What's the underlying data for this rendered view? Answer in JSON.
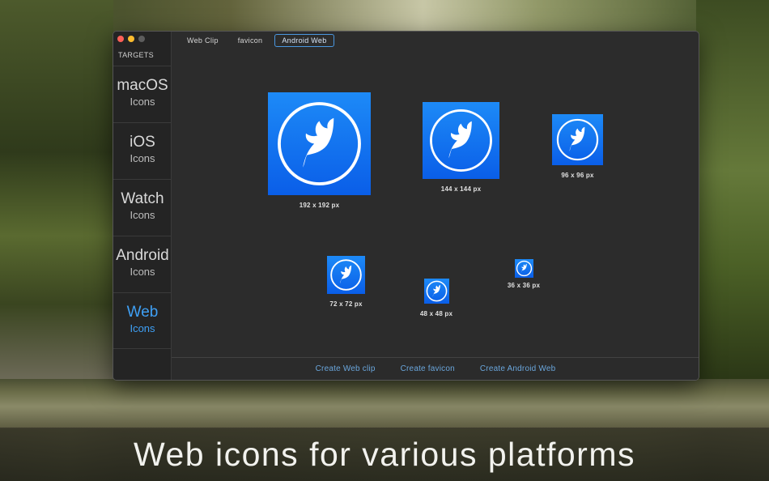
{
  "window": {
    "targets_label": "TARGETS"
  },
  "sidebar": {
    "items": [
      {
        "title": "macOS",
        "subtitle": "Icons",
        "active": false
      },
      {
        "title": "iOS",
        "subtitle": "Icons",
        "active": false
      },
      {
        "title": "Watch",
        "subtitle": "Icons",
        "active": false
      },
      {
        "title": "Android",
        "subtitle": "Icons",
        "active": false
      },
      {
        "title": "Web",
        "subtitle": "Icons",
        "active": true
      }
    ]
  },
  "tabs": [
    {
      "label": "Web Clip",
      "selected": false
    },
    {
      "label": "favicon",
      "selected": false
    },
    {
      "label": "Android Web",
      "selected": true
    }
  ],
  "icons": [
    {
      "label": "192 x 192 px",
      "icon": "feather-icon"
    },
    {
      "label": "144 x 144 px",
      "icon": "feather-icon"
    },
    {
      "label": "96 x 96 px",
      "icon": "feather-icon"
    },
    {
      "label": "72 x 72 px",
      "icon": "feather-icon"
    },
    {
      "label": "48 x 48 px",
      "icon": "feather-icon"
    },
    {
      "label": "36 x 36 px",
      "icon": "feather-icon"
    }
  ],
  "footer": {
    "create_web_clip": "Create Web clip",
    "create_favicon": "Create favicon",
    "create_android_web": "Create Android Web"
  },
  "caption": "Web icons for various platforms",
  "colors": {
    "accent": "#3fa0f5",
    "icon_blue_top": "#1d8af7",
    "icon_blue_bottom": "#0a5ee8",
    "footer_link": "#6aa6dc"
  }
}
